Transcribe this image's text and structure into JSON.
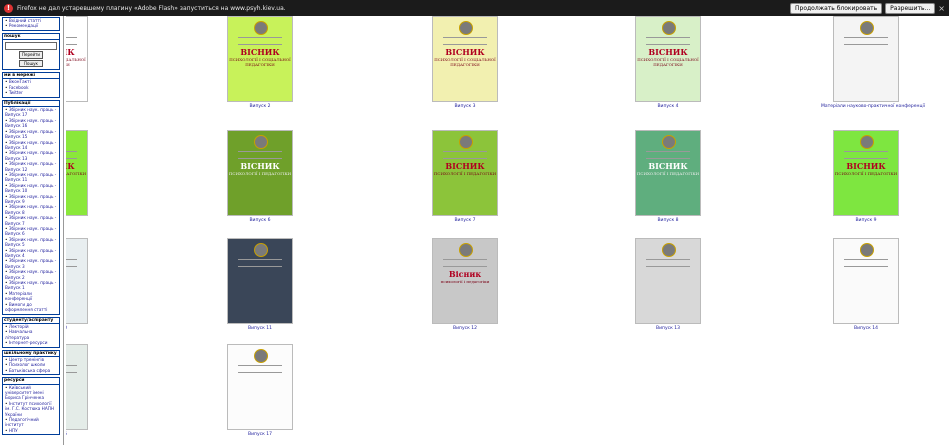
{
  "notification": {
    "message": "Firefox не дал устаревшему плагину «Adobe Flash» запуститься на www.psyh.kiev.ua.",
    "continue_blocking": "Продолжать блокировать",
    "allow": "Разрешить..."
  },
  "sidebar": {
    "top_items": [
      "Вхідний статті",
      "Рекомендації"
    ],
    "search": {
      "title": "пошук",
      "go_label": "Перейти",
      "search_label": "Пошук"
    },
    "social": {
      "title": "ми в мережі",
      "items": [
        "ВконТакті",
        "Facebook",
        "Twitter"
      ]
    },
    "publications": {
      "title": "Публікації",
      "items": [
        "Збірник наук. праць - Випуск 17",
        "Збірник наук. праць - Випуск 16",
        "Збірник наук. праць - Випуск 15",
        "Збірник наук. праць - Випуск 14",
        "Збірник наук. праць - Випуск 13",
        "Збірник наук. праць - Випуск 12",
        "Збірник наук. праць - Випуск 11",
        "Збірник наук. праць - Випуск 10",
        "Збірник наук. праць - Випуск 9",
        "Збірник наук. праць - Випуск 8",
        "Збірник наук. праць - Випуск 7",
        "Збірник наук. праць - Випуск 6",
        "Збірник наук. праць - Випуск 5",
        "Збірник наук. праць - Випуск 4",
        "Збірник наук. праць - Випуск 3",
        "Збірник наук. праць - Випуск 2",
        "Збірник наук. праць - Випуск 1",
        "Матеріали конференції",
        "Вимоги до оформлення статті"
      ]
    },
    "students": {
      "title": "студенту/аспіранту",
      "items": [
        "Лекторій",
        "Навчальна література",
        "Інтернет-ресурси"
      ]
    },
    "school": {
      "title": "шкільному практику",
      "items": [
        "Центр тренінгів",
        "Психолог школи",
        "Батьківська сфера"
      ]
    },
    "links": {
      "title": "ресурси",
      "items": [
        "Київський університет імені Бориса Грінченка",
        "Інститут психології ім. Г.С. Костюка НАПН України",
        "Педагогічний інститут",
        "НПУ"
      ]
    }
  },
  "gallery": [
    {
      "caption": "Випуск 1",
      "bg": "#ffffff",
      "title": "ВІСНИК",
      "subtitle": "ПСИХОЛОГІЇ І СОЦІАЛЬНОЇ ПЕДАГОГІКИ"
    },
    {
      "caption": "Випуск 2",
      "bg": "#c8f25a",
      "title": "ВІСНИК",
      "subtitle": "ПСИХОЛОГІЇ І СОЦІАЛЬНОЇ ПЕДАГОГІКИ"
    },
    {
      "caption": "Випуск 3",
      "bg": "#f2f0b0",
      "title": "ВІСНИК",
      "subtitle": "ПСИХОЛОГІЇ І СОЦІАЛЬНОЇ ПЕДАГОГІКИ"
    },
    {
      "caption": "Випуск 4",
      "bg": "#d8f0c8",
      "title": "ВІСНИК",
      "subtitle": "ПСИХОЛОГІЇ І СОЦІАЛЬНОЇ ПЕДАГОГІКИ"
    },
    {
      "caption": "Матеріали науково-практичної конференції",
      "bg": "#f4f4f4",
      "title": "",
      "subtitle": ""
    },
    {
      "caption": "Випуск 5",
      "bg": "#8ae83a",
      "title": "ВІСНИК",
      "subtitle": "ПСИХОЛОГІЇ І ПЕДАГОГІКИ"
    },
    {
      "caption": "Випуск 6",
      "bg": "#6fa02a",
      "title": "ВІСНИК",
      "subtitle": "ПСИХОЛОГІЇ І ПЕДАГОГІКИ"
    },
    {
      "caption": "Випуск 7",
      "bg": "#8cc43a",
      "title": "ВІСНИК",
      "subtitle": "ПСИХОЛОГІЇ І ПЕДАГОГІКИ"
    },
    {
      "caption": "Випуск 8",
      "bg": "#5fae7e",
      "title": "ВІСНИК",
      "subtitle": "ПСИХОЛОГІЇ І ПЕДАГОГІКИ"
    },
    {
      "caption": "Випуск 9",
      "bg": "#7ee640",
      "title": "ВІСНИК",
      "subtitle": "ПСИХОЛОГІЇ І ПЕДАГОГІКИ"
    },
    {
      "caption": "Випуск 10",
      "bg": "#e8eef0",
      "title": "",
      "subtitle": ""
    },
    {
      "caption": "Випуск 11",
      "bg": "#3a4658",
      "title": "",
      "subtitle": ""
    },
    {
      "caption": "Випуск 12",
      "bg": "#c8c8c8",
      "title": "Вісник",
      "subtitle": "психології і педагогіки"
    },
    {
      "caption": "Випуск 13",
      "bg": "#d8d8d8",
      "title": "",
      "subtitle": ""
    },
    {
      "caption": "Випуск 14",
      "bg": "#fafafa",
      "title": "",
      "subtitle": ""
    },
    {
      "caption": "Випуск 15",
      "bg": "#e4ece8",
      "title": "",
      "subtitle": ""
    },
    {
      "caption": "Випуск 17",
      "bg": "#fcfcfc",
      "title": "",
      "subtitle": ""
    }
  ]
}
